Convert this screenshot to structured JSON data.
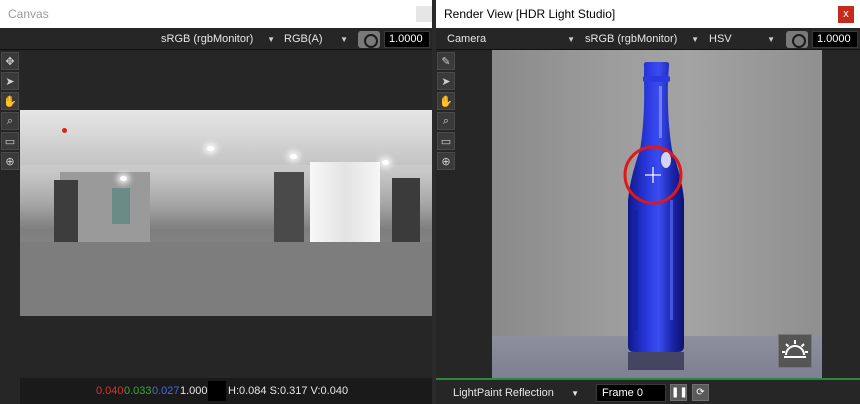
{
  "canvas": {
    "title": "Canvas",
    "toolbar": {
      "colorspace": "sRGB (rgbMonitor)",
      "channel": "RGB(A)",
      "exposure": "1.0000"
    },
    "tools": [
      "move-tool",
      "select-tool",
      "pan-tool",
      "zoom-tool",
      "region-tool",
      "zoom-region-tool"
    ],
    "status": {
      "r": "0.040",
      "g": "0.033",
      "b": "0.027",
      "a": "1.000",
      "hsv": "H:0.084 S:0.317 V:0.040"
    },
    "colors": {
      "r": "#e03030",
      "g": "#3aa83a",
      "b": "#4a6ae0",
      "a": "#e6e6e6"
    }
  },
  "render": {
    "title": "Render View [HDR Light Studio]",
    "close": "x",
    "toolbar": {
      "camera": "Camera",
      "colorspace": "sRGB (rgbMonitor)",
      "mode": "HSV",
      "exposure": "1.0000"
    },
    "tools": [
      "paint-brush-tool",
      "select-tool",
      "pan-tool",
      "zoom-tool",
      "region-tool",
      "zoom-region-tool"
    ],
    "bottom": {
      "lightpaint_mode": "LightPaint Reflection",
      "frame": "Frame 0"
    },
    "colors": {
      "bottle": "#1e2fc0",
      "highlight_circle": "#e01818",
      "progress": "#2a8a3a"
    }
  }
}
